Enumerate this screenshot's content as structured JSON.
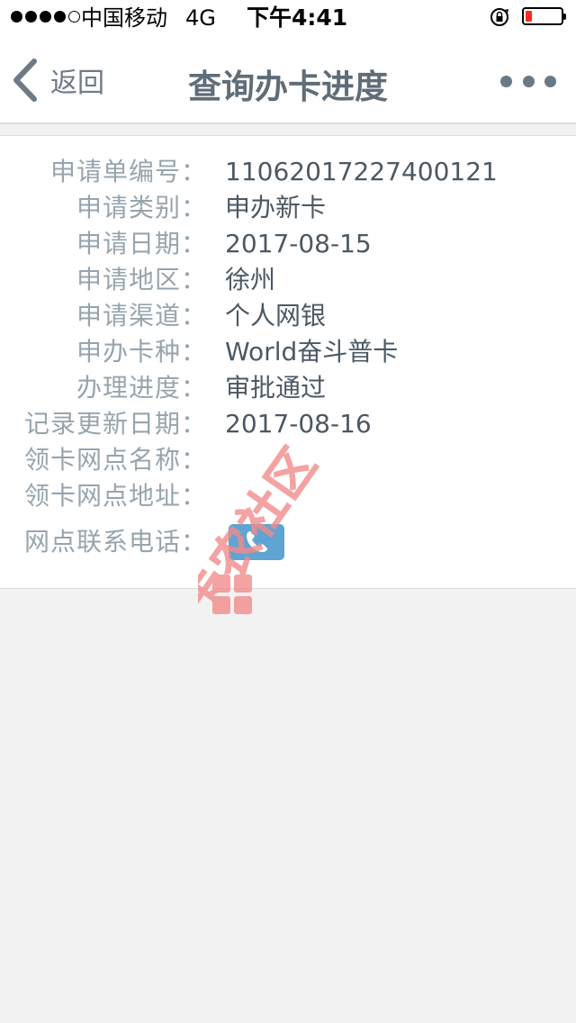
{
  "status_bar": {
    "carrier": "中国移动",
    "network": "4G",
    "time": "下午4:41",
    "signal_strength": 4,
    "battery_level": 0.18
  },
  "nav": {
    "back_label": "返回",
    "title": "查询办卡进度"
  },
  "details": [
    {
      "label": "申请单编号：",
      "value": "11062017227400121"
    },
    {
      "label": "申请类别：",
      "value": "申办新卡"
    },
    {
      "label": "申请日期：",
      "value": "2017-08-15"
    },
    {
      "label": "申请地区：",
      "value": "徐州"
    },
    {
      "label": "申请渠道：",
      "value": "个人网银"
    },
    {
      "label": "申办卡种：",
      "value": "World奋斗普卡"
    },
    {
      "label": "办理进度：",
      "value": "审批通过"
    },
    {
      "label": "记录更新日期：",
      "value": "2017-08-16"
    },
    {
      "label": "领卡网点名称：",
      "value": ""
    },
    {
      "label": "领卡网点地址：",
      "value": ""
    }
  ],
  "contact": {
    "label": "网点联系电话："
  },
  "colors": {
    "label": "#97a4ad",
    "value": "#4c5863",
    "title": "#5f6d78",
    "phone_button": "#5fa4d2",
    "watermark": "#f28b8b"
  },
  "watermark_text": "卡农社区"
}
